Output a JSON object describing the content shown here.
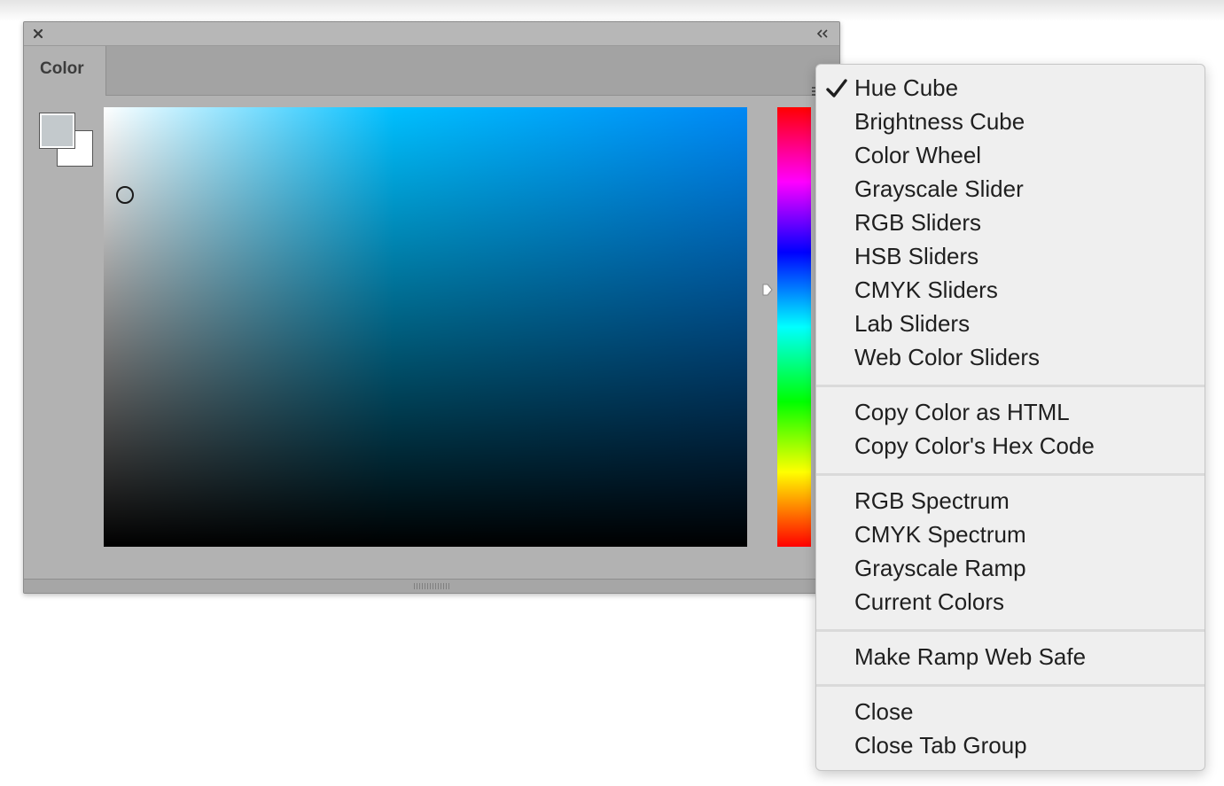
{
  "panel": {
    "tab_label": "Color",
    "selected_fill_color": "#c3c9cc",
    "stroke_color": "#ffffff",
    "selected_hue_color": "#00bfff"
  },
  "icons": {
    "close": "close-icon",
    "collapse": "double-chevron-left-icon",
    "panel_menu": "menu-lines-icon",
    "checkmark": "checkmark-icon"
  },
  "menu": {
    "items": [
      {
        "label": "Hue Cube",
        "checked": true
      },
      {
        "label": "Brightness Cube"
      },
      {
        "label": "Color Wheel"
      },
      {
        "label": "Grayscale Slider"
      },
      {
        "label": "RGB Sliders"
      },
      {
        "label": "HSB Sliders"
      },
      {
        "label": "CMYK Sliders"
      },
      {
        "label": "Lab Sliders"
      },
      {
        "label": "Web Color Sliders"
      },
      {
        "label": "Copy Color as HTML"
      },
      {
        "label": "Copy Color's Hex Code"
      },
      {
        "label": "RGB Spectrum"
      },
      {
        "label": "CMYK Spectrum"
      },
      {
        "label": "Grayscale Ramp"
      },
      {
        "label": "Current Colors"
      },
      {
        "label": "Make Ramp Web Safe"
      },
      {
        "label": "Close"
      },
      {
        "label": "Close Tab Group"
      }
    ]
  }
}
